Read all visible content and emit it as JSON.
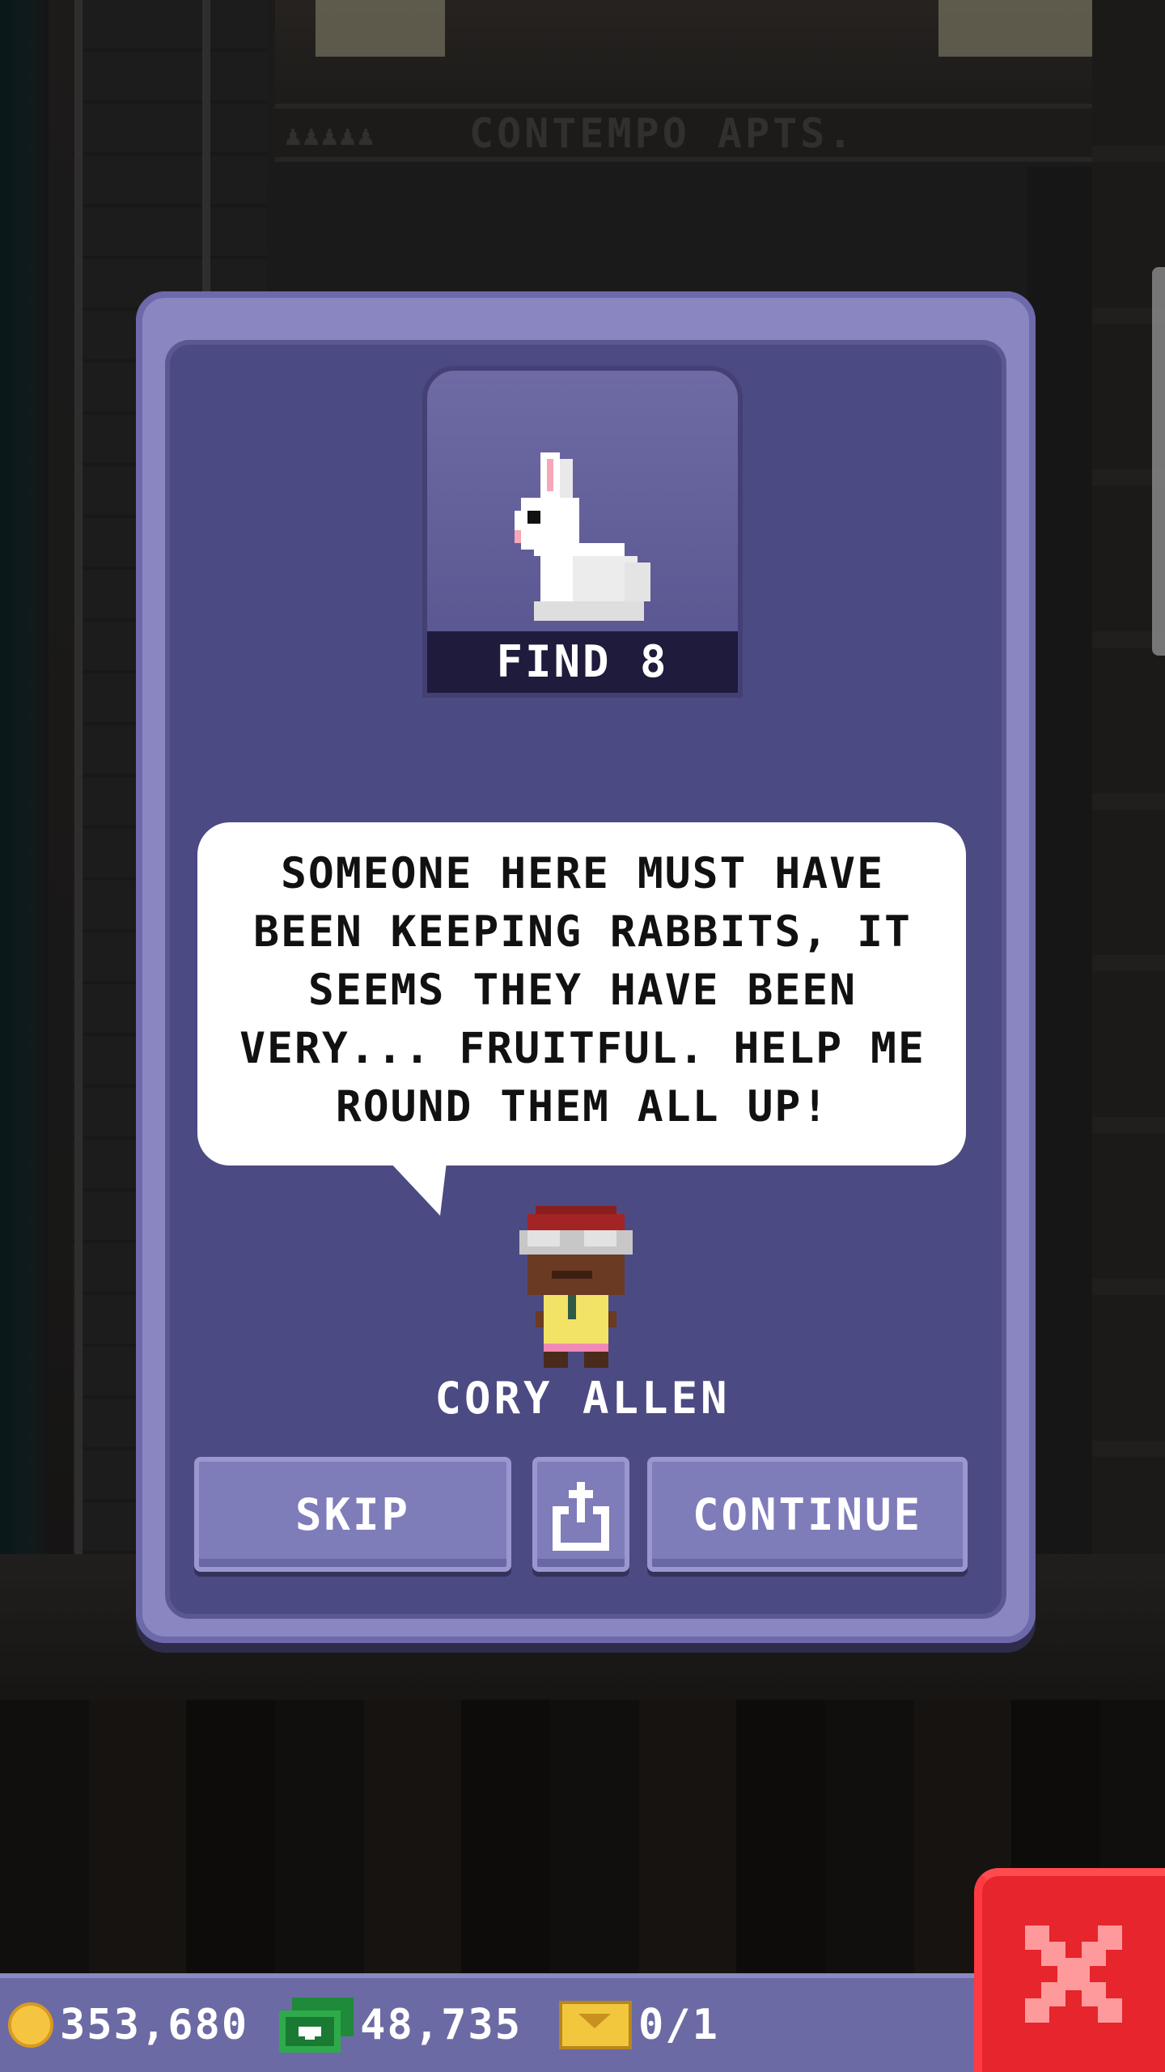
{
  "background": {
    "building_sign": "CONTEMPO APTS."
  },
  "dialog": {
    "task": {
      "icon": "rabbit-icon",
      "label": "FIND 8"
    },
    "message": "SOMEONE HERE MUST HAVE BEEN KEEPING RABBITS, IT SEEMS THEY HAVE BEEN VERY... FRUITFUL. HELP ME ROUND THEM ALL UP!",
    "speaker": "CORY ALLEN",
    "buttons": {
      "skip": "SKIP",
      "share_icon": "share-icon",
      "continue": "CONTINUE"
    }
  },
  "hud": {
    "coins": "353,680",
    "bux": "48,735",
    "tickets": "0/1"
  },
  "colors": {
    "dialog_frame": "#8a86c2",
    "dialog_body": "#4c4a82",
    "button": "#7f7cba",
    "close_button": "#e6252c",
    "hud_bar": "#6b6aa4"
  }
}
